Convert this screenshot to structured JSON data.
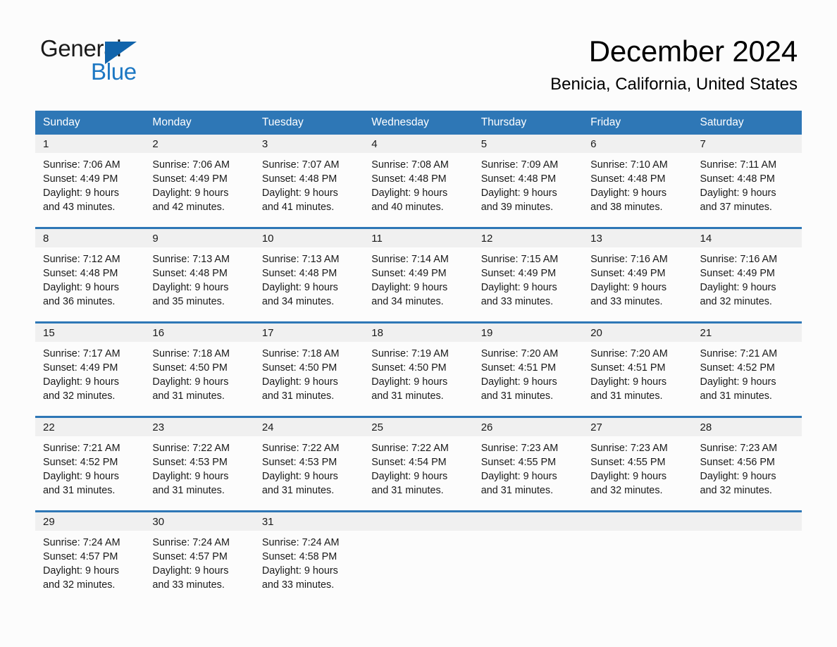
{
  "brand": {
    "word1": "General",
    "word2": "Blue",
    "triangle_color": "#1164ab",
    "blue_color": "#1c77c3"
  },
  "header": {
    "month_title": "December 2024",
    "location": "Benicia, California, United States"
  },
  "theme": {
    "header_blue": "#2e77b6",
    "daynum_strip": "#f0f0f0",
    "page_background": "#fcfcfc",
    "text": "#1a1a1a"
  },
  "weekday_headers": [
    "Sunday",
    "Monday",
    "Tuesday",
    "Wednesday",
    "Thursday",
    "Friday",
    "Saturday"
  ],
  "weeks": [
    [
      {
        "day": "1",
        "sunrise": "Sunrise: 7:06 AM",
        "sunset": "Sunset: 4:49 PM",
        "daylight1": "Daylight: 9 hours",
        "daylight2": "and 43 minutes."
      },
      {
        "day": "2",
        "sunrise": "Sunrise: 7:06 AM",
        "sunset": "Sunset: 4:49 PM",
        "daylight1": "Daylight: 9 hours",
        "daylight2": "and 42 minutes."
      },
      {
        "day": "3",
        "sunrise": "Sunrise: 7:07 AM",
        "sunset": "Sunset: 4:48 PM",
        "daylight1": "Daylight: 9 hours",
        "daylight2": "and 41 minutes."
      },
      {
        "day": "4",
        "sunrise": "Sunrise: 7:08 AM",
        "sunset": "Sunset: 4:48 PM",
        "daylight1": "Daylight: 9 hours",
        "daylight2": "and 40 minutes."
      },
      {
        "day": "5",
        "sunrise": "Sunrise: 7:09 AM",
        "sunset": "Sunset: 4:48 PM",
        "daylight1": "Daylight: 9 hours",
        "daylight2": "and 39 minutes."
      },
      {
        "day": "6",
        "sunrise": "Sunrise: 7:10 AM",
        "sunset": "Sunset: 4:48 PM",
        "daylight1": "Daylight: 9 hours",
        "daylight2": "and 38 minutes."
      },
      {
        "day": "7",
        "sunrise": "Sunrise: 7:11 AM",
        "sunset": "Sunset: 4:48 PM",
        "daylight1": "Daylight: 9 hours",
        "daylight2": "and 37 minutes."
      }
    ],
    [
      {
        "day": "8",
        "sunrise": "Sunrise: 7:12 AM",
        "sunset": "Sunset: 4:48 PM",
        "daylight1": "Daylight: 9 hours",
        "daylight2": "and 36 minutes."
      },
      {
        "day": "9",
        "sunrise": "Sunrise: 7:13 AM",
        "sunset": "Sunset: 4:48 PM",
        "daylight1": "Daylight: 9 hours",
        "daylight2": "and 35 minutes."
      },
      {
        "day": "10",
        "sunrise": "Sunrise: 7:13 AM",
        "sunset": "Sunset: 4:48 PM",
        "daylight1": "Daylight: 9 hours",
        "daylight2": "and 34 minutes."
      },
      {
        "day": "11",
        "sunrise": "Sunrise: 7:14 AM",
        "sunset": "Sunset: 4:49 PM",
        "daylight1": "Daylight: 9 hours",
        "daylight2": "and 34 minutes."
      },
      {
        "day": "12",
        "sunrise": "Sunrise: 7:15 AM",
        "sunset": "Sunset: 4:49 PM",
        "daylight1": "Daylight: 9 hours",
        "daylight2": "and 33 minutes."
      },
      {
        "day": "13",
        "sunrise": "Sunrise: 7:16 AM",
        "sunset": "Sunset: 4:49 PM",
        "daylight1": "Daylight: 9 hours",
        "daylight2": "and 33 minutes."
      },
      {
        "day": "14",
        "sunrise": "Sunrise: 7:16 AM",
        "sunset": "Sunset: 4:49 PM",
        "daylight1": "Daylight: 9 hours",
        "daylight2": "and 32 minutes."
      }
    ],
    [
      {
        "day": "15",
        "sunrise": "Sunrise: 7:17 AM",
        "sunset": "Sunset: 4:49 PM",
        "daylight1": "Daylight: 9 hours",
        "daylight2": "and 32 minutes."
      },
      {
        "day": "16",
        "sunrise": "Sunrise: 7:18 AM",
        "sunset": "Sunset: 4:50 PM",
        "daylight1": "Daylight: 9 hours",
        "daylight2": "and 31 minutes."
      },
      {
        "day": "17",
        "sunrise": "Sunrise: 7:18 AM",
        "sunset": "Sunset: 4:50 PM",
        "daylight1": "Daylight: 9 hours",
        "daylight2": "and 31 minutes."
      },
      {
        "day": "18",
        "sunrise": "Sunrise: 7:19 AM",
        "sunset": "Sunset: 4:50 PM",
        "daylight1": "Daylight: 9 hours",
        "daylight2": "and 31 minutes."
      },
      {
        "day": "19",
        "sunrise": "Sunrise: 7:20 AM",
        "sunset": "Sunset: 4:51 PM",
        "daylight1": "Daylight: 9 hours",
        "daylight2": "and 31 minutes."
      },
      {
        "day": "20",
        "sunrise": "Sunrise: 7:20 AM",
        "sunset": "Sunset: 4:51 PM",
        "daylight1": "Daylight: 9 hours",
        "daylight2": "and 31 minutes."
      },
      {
        "day": "21",
        "sunrise": "Sunrise: 7:21 AM",
        "sunset": "Sunset: 4:52 PM",
        "daylight1": "Daylight: 9 hours",
        "daylight2": "and 31 minutes."
      }
    ],
    [
      {
        "day": "22",
        "sunrise": "Sunrise: 7:21 AM",
        "sunset": "Sunset: 4:52 PM",
        "daylight1": "Daylight: 9 hours",
        "daylight2": "and 31 minutes."
      },
      {
        "day": "23",
        "sunrise": "Sunrise: 7:22 AM",
        "sunset": "Sunset: 4:53 PM",
        "daylight1": "Daylight: 9 hours",
        "daylight2": "and 31 minutes."
      },
      {
        "day": "24",
        "sunrise": "Sunrise: 7:22 AM",
        "sunset": "Sunset: 4:53 PM",
        "daylight1": "Daylight: 9 hours",
        "daylight2": "and 31 minutes."
      },
      {
        "day": "25",
        "sunrise": "Sunrise: 7:22 AM",
        "sunset": "Sunset: 4:54 PM",
        "daylight1": "Daylight: 9 hours",
        "daylight2": "and 31 minutes."
      },
      {
        "day": "26",
        "sunrise": "Sunrise: 7:23 AM",
        "sunset": "Sunset: 4:55 PM",
        "daylight1": "Daylight: 9 hours",
        "daylight2": "and 31 minutes."
      },
      {
        "day": "27",
        "sunrise": "Sunrise: 7:23 AM",
        "sunset": "Sunset: 4:55 PM",
        "daylight1": "Daylight: 9 hours",
        "daylight2": "and 32 minutes."
      },
      {
        "day": "28",
        "sunrise": "Sunrise: 7:23 AM",
        "sunset": "Sunset: 4:56 PM",
        "daylight1": "Daylight: 9 hours",
        "daylight2": "and 32 minutes."
      }
    ],
    [
      {
        "day": "29",
        "sunrise": "Sunrise: 7:24 AM",
        "sunset": "Sunset: 4:57 PM",
        "daylight1": "Daylight: 9 hours",
        "daylight2": "and 32 minutes."
      },
      {
        "day": "30",
        "sunrise": "Sunrise: 7:24 AM",
        "sunset": "Sunset: 4:57 PM",
        "daylight1": "Daylight: 9 hours",
        "daylight2": "and 33 minutes."
      },
      {
        "day": "31",
        "sunrise": "Sunrise: 7:24 AM",
        "sunset": "Sunset: 4:58 PM",
        "daylight1": "Daylight: 9 hours",
        "daylight2": "and 33 minutes."
      },
      {
        "day": "",
        "sunrise": "",
        "sunset": "",
        "daylight1": "",
        "daylight2": ""
      },
      {
        "day": "",
        "sunrise": "",
        "sunset": "",
        "daylight1": "",
        "daylight2": ""
      },
      {
        "day": "",
        "sunrise": "",
        "sunset": "",
        "daylight1": "",
        "daylight2": ""
      },
      {
        "day": "",
        "sunrise": "",
        "sunset": "",
        "daylight1": "",
        "daylight2": ""
      }
    ]
  ]
}
